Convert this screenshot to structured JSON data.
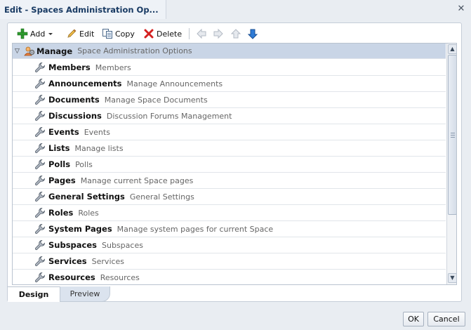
{
  "dialog": {
    "title": "Edit - Spaces Administration Op...",
    "close_glyph": "✕"
  },
  "toolbar": {
    "add_label": "Add",
    "edit_label": "Edit",
    "copy_label": "Copy",
    "delete_label": "Delete"
  },
  "tree": {
    "root": {
      "expander": "▽",
      "name": "Manage",
      "desc": "Space Administration Options"
    },
    "items": [
      {
        "name": "Members",
        "desc": "Members"
      },
      {
        "name": "Announcements",
        "desc": "Manage Announcements"
      },
      {
        "name": "Documents",
        "desc": "Manage Space Documents"
      },
      {
        "name": "Discussions",
        "desc": "Discussion Forums Management"
      },
      {
        "name": "Events",
        "desc": "Events"
      },
      {
        "name": "Lists",
        "desc": "Manage lists"
      },
      {
        "name": "Polls",
        "desc": "Polls"
      },
      {
        "name": "Pages",
        "desc": "Manage current Space pages"
      },
      {
        "name": "General Settings",
        "desc": "General Settings"
      },
      {
        "name": "Roles",
        "desc": "Roles"
      },
      {
        "name": "System Pages",
        "desc": "Manage system pages for current Space"
      },
      {
        "name": "Subspaces",
        "desc": "Subspaces"
      },
      {
        "name": "Services",
        "desc": "Services"
      },
      {
        "name": "Resources",
        "desc": "Resources"
      }
    ]
  },
  "tabs": {
    "design": "Design",
    "preview": "Preview"
  },
  "buttons": {
    "ok": "OK",
    "cancel": "Cancel"
  },
  "colors": {
    "title": "#183a63",
    "root_row_bg": "#c9d5e6",
    "add_icon": "#2e9a2e",
    "delete_icon": "#d42020",
    "down_arrow": "#2f7bd6"
  }
}
